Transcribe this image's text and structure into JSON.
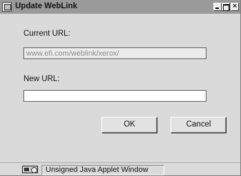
{
  "window": {
    "title": "Update WebLink",
    "title_buttons": {
      "minimize": "",
      "maximize": "",
      "close": "×"
    }
  },
  "form": {
    "current_url_label": "Current URL:",
    "current_url_value": "www.efi.com/weblink/xerox/",
    "new_url_label": "New URL:",
    "new_url_value": ""
  },
  "buttons": {
    "ok": "OK",
    "cancel": "Cancel"
  },
  "statusbar": {
    "text": "Unsigned Java Applet Window"
  },
  "colors": {
    "window_bg": "#dadada",
    "titlebar_bg": "#9a9a9a",
    "disabled_text": "#8a8a8a"
  },
  "icons": {
    "app": "window-app-icon",
    "status": "applet-warning-icon"
  }
}
